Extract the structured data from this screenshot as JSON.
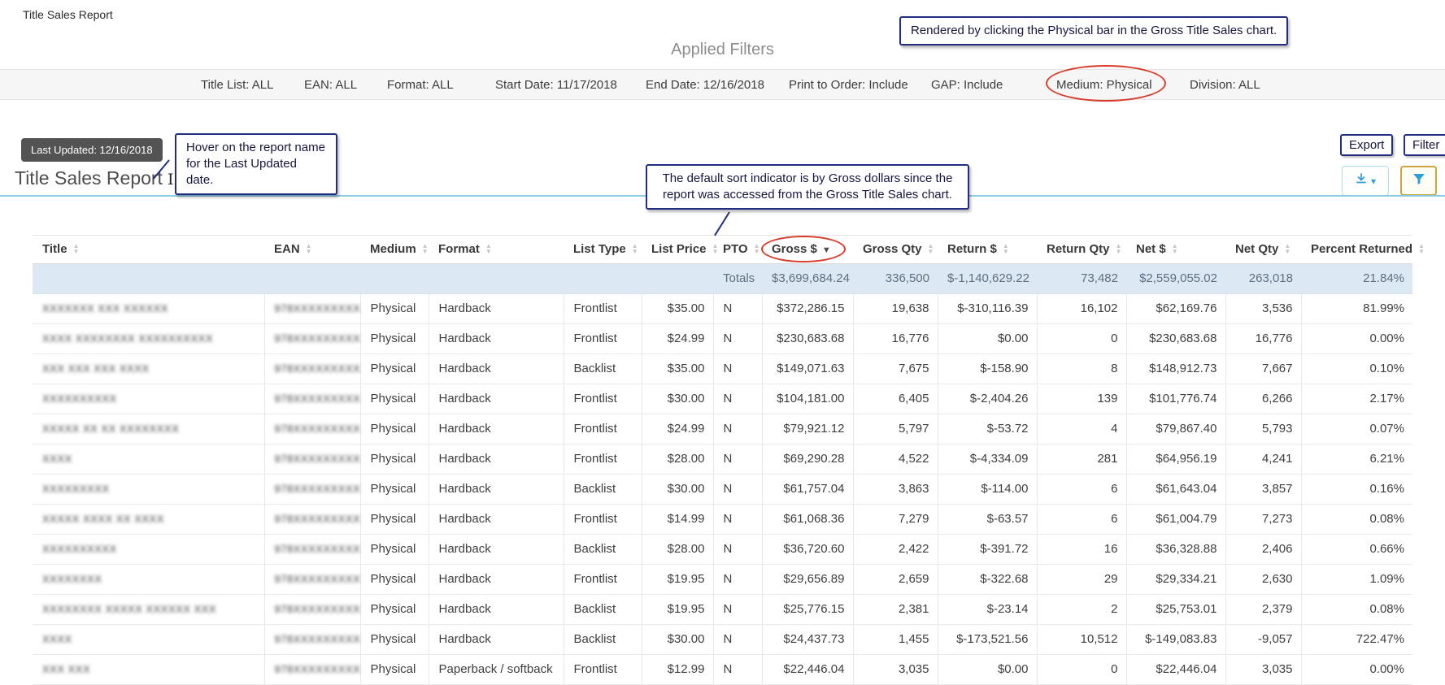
{
  "header": {
    "app_title": "Title Sales Report"
  },
  "applied_filters": {
    "heading": "Applied Filters",
    "items": [
      "Title List: ALL",
      "EAN: ALL",
      "Format: ALL",
      "Start Date: 11/17/2018",
      "End Date: 12/16/2018",
      "Print to Order: Include",
      "GAP: Include",
      "Medium: Physical",
      "Division: ALL"
    ]
  },
  "annotations": {
    "chart_note": "Rendered by clicking the Physical bar in the Gross Title Sales chart.",
    "hover_note": "Hover on the report name for the Last Updated date.",
    "sort_note": "The default sort indicator is by Gross dollars since the report was accessed from the Gross Title Sales chart.",
    "export_label": "Export",
    "filter_label": "Filter"
  },
  "tooltip": {
    "text": "Last Updated: 12/16/2018"
  },
  "page": {
    "title": "Title Sales Report"
  },
  "accent_colors": {
    "highlight_red": "#d93b2b",
    "callout_navy": "#232d7f",
    "filter_button_gold": "#cfa43b",
    "icon_blue": "#2b9fd9",
    "totals_row_blue": "#dce8f3",
    "divider_blue": "#8ccbe8"
  },
  "table": {
    "columns": [
      "Title",
      "EAN",
      "Medium",
      "Format",
      "List Type",
      "List Price",
      "PTO",
      "Gross $",
      "Gross Qty",
      "Return $",
      "Return Qty",
      "Net $",
      "Net Qty",
      "Percent Returned"
    ],
    "sorted_column": "Gross $",
    "sort_direction": "desc",
    "totals": {
      "label": "Totals",
      "gross": "$3,699,684.24",
      "gross_qty": "336,500",
      "return": "$-1,140,629.22",
      "return_qty": "73,482",
      "net": "$2,559,055.02",
      "net_qty": "263,018",
      "percent": "21.84%"
    },
    "rows": [
      {
        "title": "XXXXXXX XXX XXXXXX",
        "ean": "978XXXXXXXXX",
        "medium": "Physical",
        "format": "Hardback",
        "list_type": "Frontlist",
        "list_price": "$35.00",
        "pto": "N",
        "gross": "$372,286.15",
        "gross_qty": "19,638",
        "return": "$-310,116.39",
        "return_qty": "16,102",
        "net": "$62,169.76",
        "net_qty": "3,536",
        "percent": "81.99%"
      },
      {
        "title": "XXXX XXXXXXXX XXXXXXXXXX",
        "ean": "978XXXXXXXXX",
        "medium": "Physical",
        "format": "Hardback",
        "list_type": "Frontlist",
        "list_price": "$24.99",
        "pto": "N",
        "gross": "$230,683.68",
        "gross_qty": "16,776",
        "return": "$0.00",
        "return_qty": "0",
        "net": "$230,683.68",
        "net_qty": "16,776",
        "percent": "0.00%"
      },
      {
        "title": "XXX XXX XXX XXXX",
        "ean": "978XXXXXXXXX",
        "medium": "Physical",
        "format": "Hardback",
        "list_type": "Backlist",
        "list_price": "$35.00",
        "pto": "N",
        "gross": "$149,071.63",
        "gross_qty": "7,675",
        "return": "$-158.90",
        "return_qty": "8",
        "net": "$148,912.73",
        "net_qty": "7,667",
        "percent": "0.10%"
      },
      {
        "title": "XXXXXXXXXX",
        "ean": "978XXXXXXXXX",
        "medium": "Physical",
        "format": "Hardback",
        "list_type": "Frontlist",
        "list_price": "$30.00",
        "pto": "N",
        "gross": "$104,181.00",
        "gross_qty": "6,405",
        "return": "$-2,404.26",
        "return_qty": "139",
        "net": "$101,776.74",
        "net_qty": "6,266",
        "percent": "2.17%"
      },
      {
        "title": "XXXXX XX XX XXXXXXXX",
        "ean": "978XXXXXXXXX",
        "medium": "Physical",
        "format": "Hardback",
        "list_type": "Frontlist",
        "list_price": "$24.99",
        "pto": "N",
        "gross": "$79,921.12",
        "gross_qty": "5,797",
        "return": "$-53.72",
        "return_qty": "4",
        "net": "$79,867.40",
        "net_qty": "5,793",
        "percent": "0.07%"
      },
      {
        "title": "XXXX",
        "ean": "978XXXXXXXXX",
        "medium": "Physical",
        "format": "Hardback",
        "list_type": "Frontlist",
        "list_price": "$28.00",
        "pto": "N",
        "gross": "$69,290.28",
        "gross_qty": "4,522",
        "return": "$-4,334.09",
        "return_qty": "281",
        "net": "$64,956.19",
        "net_qty": "4,241",
        "percent": "6.21%"
      },
      {
        "title": "XXXXXXXXX",
        "ean": "978XXXXXXXXX",
        "medium": "Physical",
        "format": "Hardback",
        "list_type": "Backlist",
        "list_price": "$30.00",
        "pto": "N",
        "gross": "$61,757.04",
        "gross_qty": "3,863",
        "return": "$-114.00",
        "return_qty": "6",
        "net": "$61,643.04",
        "net_qty": "3,857",
        "percent": "0.16%"
      },
      {
        "title": "XXXXX XXXX XX XXXX",
        "ean": "978XXXXXXXXX",
        "medium": "Physical",
        "format": "Hardback",
        "list_type": "Frontlist",
        "list_price": "$14.99",
        "pto": "N",
        "gross": "$61,068.36",
        "gross_qty": "7,279",
        "return": "$-63.57",
        "return_qty": "6",
        "net": "$61,004.79",
        "net_qty": "7,273",
        "percent": "0.08%"
      },
      {
        "title": "XXXXXXXXXX",
        "ean": "978XXXXXXXXX",
        "medium": "Physical",
        "format": "Hardback",
        "list_type": "Backlist",
        "list_price": "$28.00",
        "pto": "N",
        "gross": "$36,720.60",
        "gross_qty": "2,422",
        "return": "$-391.72",
        "return_qty": "16",
        "net": "$36,328.88",
        "net_qty": "2,406",
        "percent": "0.66%"
      },
      {
        "title": "XXXXXXXX",
        "ean": "978XXXXXXXXX",
        "medium": "Physical",
        "format": "Hardback",
        "list_type": "Frontlist",
        "list_price": "$19.95",
        "pto": "N",
        "gross": "$29,656.89",
        "gross_qty": "2,659",
        "return": "$-322.68",
        "return_qty": "29",
        "net": "$29,334.21",
        "net_qty": "2,630",
        "percent": "1.09%"
      },
      {
        "title": "XXXXXXXX XXXXX XXXXXX XXX",
        "ean": "978XXXXXXXXX",
        "medium": "Physical",
        "format": "Hardback",
        "list_type": "Backlist",
        "list_price": "$19.95",
        "pto": "N",
        "gross": "$25,776.15",
        "gross_qty": "2,381",
        "return": "$-23.14",
        "return_qty": "2",
        "net": "$25,753.01",
        "net_qty": "2,379",
        "percent": "0.08%"
      },
      {
        "title": "XXXX",
        "ean": "978XXXXXXXXX",
        "medium": "Physical",
        "format": "Hardback",
        "list_type": "Backlist",
        "list_price": "$30.00",
        "pto": "N",
        "gross": "$24,437.73",
        "gross_qty": "1,455",
        "return": "$-173,521.56",
        "return_qty": "10,512",
        "net": "$-149,083.83",
        "net_qty": "-9,057",
        "percent": "722.47%"
      },
      {
        "title": "XXX XXX",
        "ean": "978XXXXXXXXX",
        "medium": "Physical",
        "format": "Paperback / softback",
        "list_type": "Frontlist",
        "list_price": "$12.99",
        "pto": "N",
        "gross": "$22,446.04",
        "gross_qty": "3,035",
        "return": "$0.00",
        "return_qty": "0",
        "net": "$22,446.04",
        "net_qty": "3,035",
        "percent": "0.00%"
      }
    ]
  }
}
